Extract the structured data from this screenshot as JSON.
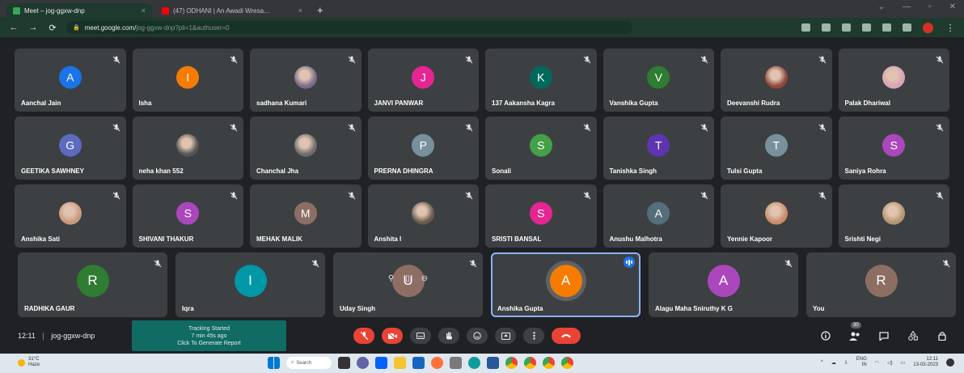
{
  "browser": {
    "tabs": [
      {
        "title": "Meet – jog-ggxw-dnp",
        "favicon_color": "#34a853",
        "active": true
      },
      {
        "title": "(47) ODHANI | An Awadi Wresa…",
        "favicon_color": "#ff0000",
        "active": false
      }
    ],
    "url_host": "meet.google.com/",
    "url_path": "jog-ggxw-dnp?pli=1&authuser=0"
  },
  "participants": [
    {
      "name": "Aanchal Jain",
      "initial": "A",
      "color": "#1a73e8",
      "type": "initial"
    },
    {
      "name": "Isha",
      "initial": "I",
      "color": "#f57c00",
      "type": "initial"
    },
    {
      "name": "sadhana Kumari",
      "initial": "",
      "color": "#7c6a8c",
      "type": "photo"
    },
    {
      "name": "JANVI PANWAR",
      "initial": "J",
      "color": "#e52592",
      "type": "initial"
    },
    {
      "name": "137 Aakansha Kagra",
      "initial": "K",
      "color": "#00695c",
      "type": "initial"
    },
    {
      "name": "Vanshika Gupta",
      "initial": "V",
      "color": "#2e7d32",
      "type": "initial"
    },
    {
      "name": "Deevanshi Rudra",
      "initial": "",
      "color": "#8d4a3c",
      "type": "photo"
    },
    {
      "name": "Palak Dhariwal",
      "initial": "",
      "color": "#d9a3b8",
      "type": "photo"
    },
    {
      "name": "GEETIKA SAWHNEY",
      "initial": "G",
      "color": "#5c6bc0",
      "type": "initial"
    },
    {
      "name": "neha khan 552",
      "initial": "",
      "color": "#555555",
      "type": "photo"
    },
    {
      "name": "Chanchal Jha",
      "initial": "",
      "color": "#6d6d6d",
      "type": "photo"
    },
    {
      "name": "PRERNA DHINGRA",
      "initial": "P",
      "color": "#78909c",
      "type": "initial"
    },
    {
      "name": "Sonali",
      "initial": "S",
      "color": "#43a047",
      "type": "initial"
    },
    {
      "name": "Tanishka Singh",
      "initial": "T",
      "color": "#5e35b1",
      "type": "initial"
    },
    {
      "name": "Tulsi Gupta",
      "initial": "T",
      "color": "#78909c",
      "type": "initial"
    },
    {
      "name": "Saniya Rohra",
      "initial": "S",
      "color": "#ab47bc",
      "type": "initial"
    },
    {
      "name": "Anshika Sati",
      "initial": "",
      "color": "#c99a7a",
      "type": "photo"
    },
    {
      "name": "SHIVANI THAKUR",
      "initial": "S",
      "color": "#ab47bc",
      "type": "initial"
    },
    {
      "name": "MEHAK MALIK",
      "initial": "M",
      "color": "#8d6e63",
      "type": "initial"
    },
    {
      "name": "Anshita I",
      "initial": "",
      "color": "#6a5d4d",
      "type": "photo"
    },
    {
      "name": "SRISTI BANSAL",
      "initial": "S",
      "color": "#e52592",
      "type": "initial"
    },
    {
      "name": "Anushu Malhotra",
      "initial": "A",
      "color": "#546e7a",
      "type": "initial"
    },
    {
      "name": "Yennie Kapoor",
      "initial": "",
      "color": "#c98b6a",
      "type": "photo"
    },
    {
      "name": "Srishti Negi",
      "initial": "",
      "color": "#b39770",
      "type": "photo"
    },
    {
      "name": "RADHIKA GAUR",
      "initial": "R",
      "color": "#2e7d32",
      "type": "initial"
    },
    {
      "name": "Iqra",
      "initial": "I",
      "color": "#0097a7",
      "type": "initial"
    },
    {
      "name": "Uday Singh",
      "initial": "U",
      "color": "#8d6e63",
      "type": "initial"
    },
    {
      "name": "Anshika Gupta",
      "initial": "A",
      "color": "#f57c00",
      "type": "initial"
    },
    {
      "name": "Alagu Maha Sniruthy K G",
      "initial": "A",
      "color": "#ab47bc",
      "type": "initial"
    },
    {
      "name": "You",
      "initial": "R",
      "color": "#8d6e63",
      "type": "initial"
    }
  ],
  "bottom": {
    "time": "12:11",
    "separator": "|",
    "meeting_code": "jog-ggxw-dnp",
    "notice_line1": "Tracking Started",
    "notice_line2": "7 min 45s ago",
    "notice_line3": "Click To Generate Report",
    "participant_count": "30"
  },
  "taskbar": {
    "weather_temp": "31°C",
    "weather_desc": "Haze",
    "search_label": "Search",
    "lang_top": "ENG",
    "lang_bottom": "IN",
    "clock_time": "12:11",
    "clock_date": "13-03-2023"
  }
}
